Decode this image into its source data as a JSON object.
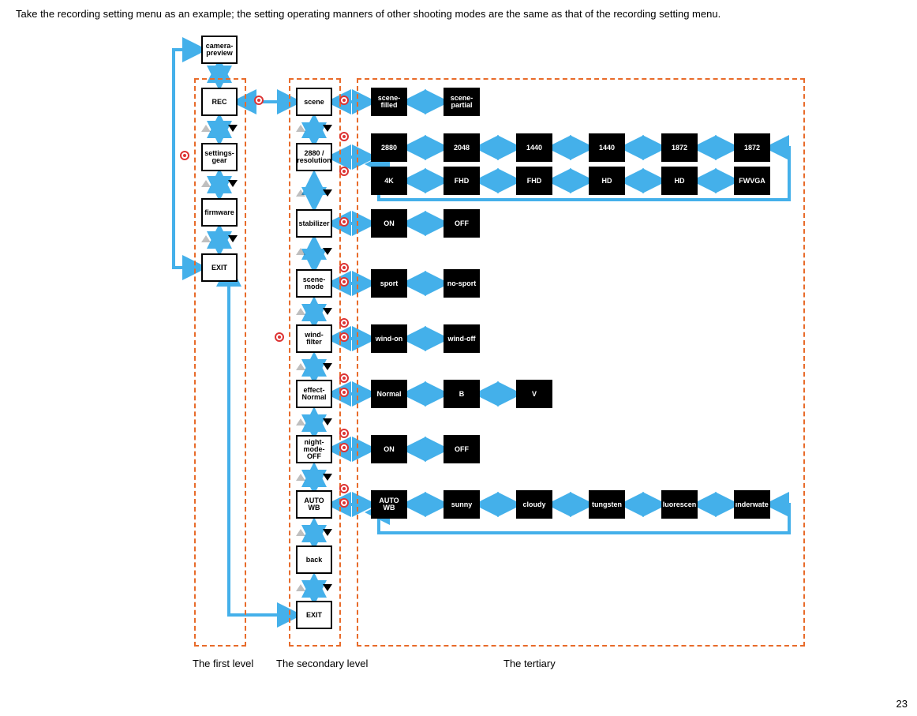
{
  "intro_text": "Take the recording setting menu as an example; the setting operating manners of other shooting modes are the same as that of the recording setting menu.",
  "page_number": "23",
  "captions": {
    "first": "The first level",
    "second": "The secondary level",
    "third": "The tertiary"
  },
  "level1": {
    "start": "camera-preview",
    "items": [
      "REC",
      "settings-gear",
      "firmware",
      "EXIT"
    ]
  },
  "level2": {
    "items": [
      "scene",
      "2880 / resolution",
      "stabilizer",
      "scene-mode",
      "wind-filter",
      "effect-Normal",
      "night-mode-OFF",
      "AUTO WB",
      "back",
      "EXIT"
    ]
  },
  "level3_rows": [
    {
      "name": "scene",
      "items": [
        "scene-filled",
        "scene-partial"
      ]
    },
    {
      "name": "resolution",
      "items": [
        "2880",
        "2048",
        "1440",
        "1440",
        "1872",
        "1872"
      ],
      "items2": [
        "4K",
        "FHD",
        "FHD",
        "HD",
        "HD",
        "FWVGA"
      ]
    },
    {
      "name": "stabilizer",
      "items": [
        "ON",
        "OFF"
      ]
    },
    {
      "name": "scene-mode",
      "items": [
        "sport",
        "no-sport"
      ]
    },
    {
      "name": "wind-filter",
      "items": [
        "wind-on",
        "wind-off"
      ]
    },
    {
      "name": "effect",
      "items": [
        "Normal",
        "B",
        "V"
      ]
    },
    {
      "name": "night-mode",
      "items": [
        "ON",
        "OFF"
      ]
    },
    {
      "name": "white-balance",
      "items": [
        "AUTO WB",
        "sunny",
        "cloudy",
        "tungsten",
        "fluorescent",
        "underwater"
      ]
    }
  ],
  "accent_color": "#44b0ea",
  "dash_color": "#e86b2a",
  "dot_color": "#d33333"
}
